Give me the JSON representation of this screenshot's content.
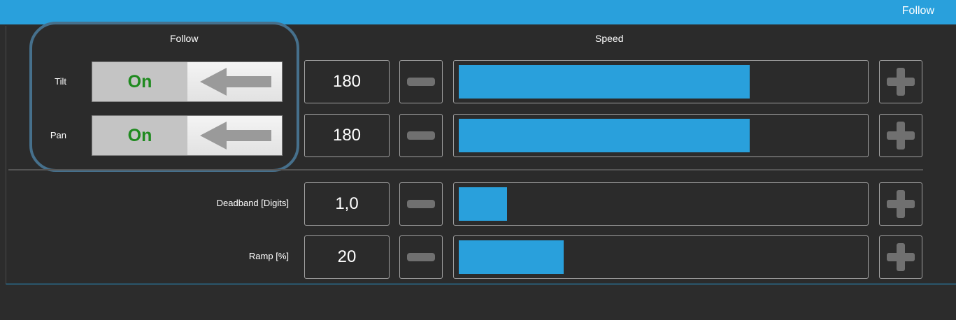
{
  "window": {
    "title": "Follow"
  },
  "headers": {
    "follow": "Follow",
    "speed": "Speed"
  },
  "colors": {
    "accent": "#29a0dc",
    "on": "#1f8a1f"
  },
  "rows": [
    {
      "label": "Tilt",
      "toggle": "On",
      "value": "180",
      "fill_fraction": 0.72
    },
    {
      "label": "Pan",
      "toggle": "On",
      "value": "180",
      "fill_fraction": 0.72
    },
    {
      "label": "Deadband [Digits]",
      "value": "1,0",
      "fill_fraction": 0.12
    },
    {
      "label": "Ramp [%]",
      "value": "20",
      "fill_fraction": 0.26
    }
  ],
  "icons": {
    "minus": "minus-icon",
    "plus": "plus-icon",
    "arrow": "arrow-left-icon"
  }
}
